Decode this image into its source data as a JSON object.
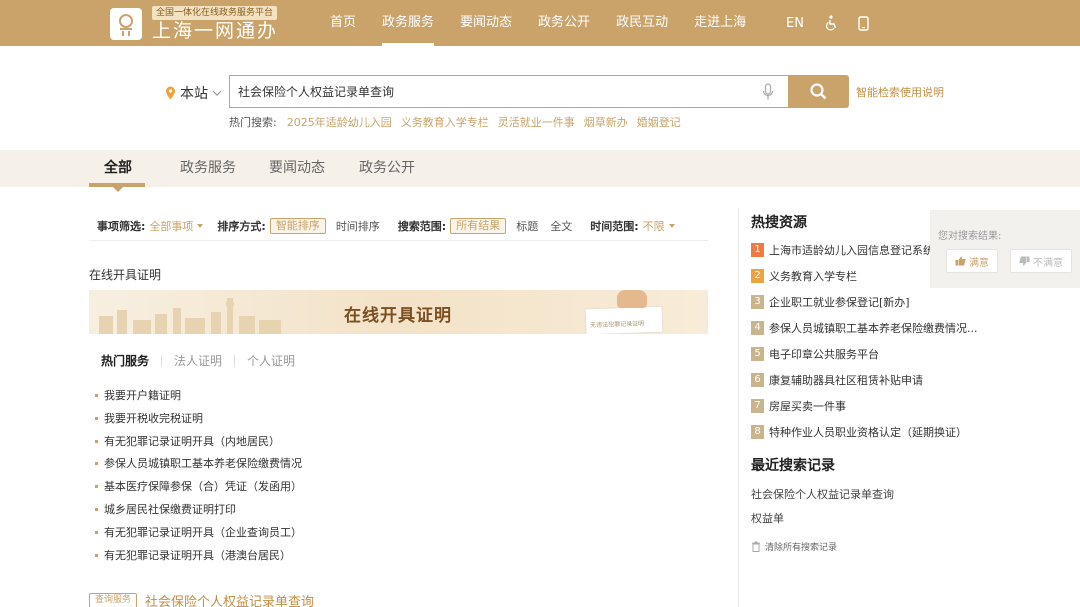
{
  "header": {
    "logo_tagline": "全国一体化在线政务服务平台",
    "logo_title": "上海一网通办",
    "nav": [
      "首页",
      "政务服务",
      "要闻动态",
      "政务公开",
      "政民互动",
      "走进上海"
    ],
    "active_nav": "政务服务",
    "lang": "EN",
    "icons": [
      "accessibility-icon",
      "mobile-icon"
    ]
  },
  "search": {
    "location": "本站",
    "query": "社会保险个人权益记录单查询",
    "help_link": "智能检索使用说明",
    "hot_label": "热门搜索:",
    "hot_terms": [
      "2025年适龄幼儿入园",
      "义务教育入学专栏",
      "灵活就业一件事",
      "烟草新办",
      "婚姻登记"
    ]
  },
  "category_tabs": [
    "全部",
    "政务服务",
    "要闻动态",
    "政务公开"
  ],
  "filters": {
    "item_label": "事项筛选:",
    "item_value": "全部事项",
    "sort_label": "排序方式:",
    "sort_options": [
      "智能排序",
      "时间排序"
    ],
    "scope_label": "搜索范围:",
    "scope_options": [
      "所有结果",
      "标题",
      "全文"
    ],
    "time_label": "时间范围:",
    "time_value": "不限"
  },
  "section": {
    "title": "在线开具证明",
    "banner_title": "在线开具证明",
    "banner_card_text": "无违法犯罪记录证明",
    "sub_tabs": [
      "热门服务",
      "法人证明",
      "个人证明"
    ],
    "services": [
      "我要开户籍证明",
      "我要开税收完税证明",
      "有无犯罪记录证明开具（内地居民）",
      "参保人员城镇职工基本养老保险缴费情况",
      "基本医疗保障参保（合）凭证（发函用）",
      "城乡居民社保缴费证明打印",
      "有无犯罪记录证明开具（企业查询员工）",
      "有无犯罪记录证明开具（港澳台居民）"
    ]
  },
  "result": {
    "tag": "查询服务",
    "title": "社会保险个人权益记录单查询"
  },
  "hot_resources": {
    "title": "热搜资源",
    "items": [
      "上海市适龄幼儿入园信息登记系统",
      "义务教育入学专栏",
      "企业职工就业参保登记[新办]",
      "参保人员城镇职工基本养老保险缴费情况...",
      "电子印章公共服务平台",
      "康复辅助器具社区租赁补贴申请",
      "房屋买卖一件事",
      "特种作业人员职业资格认定（延期换证）"
    ],
    "rank_colors": [
      "#ee7a45",
      "#f0a23c",
      "#c9b48d",
      "#c9b48d",
      "#c9b48d",
      "#c9b48d",
      "#c9b48d",
      "#c9b48d"
    ]
  },
  "recent": {
    "title": "最近搜索记录",
    "items": [
      "社会保险个人权益记录单查询",
      "权益单"
    ],
    "clear_label": "清除所有搜索记录"
  },
  "feedback": {
    "question": "您对搜索结果:",
    "satisfied": "满意",
    "unsatisfied": "不满意"
  },
  "colors": {
    "brand": "#c9a36a",
    "link_gold": "#c38e43"
  }
}
